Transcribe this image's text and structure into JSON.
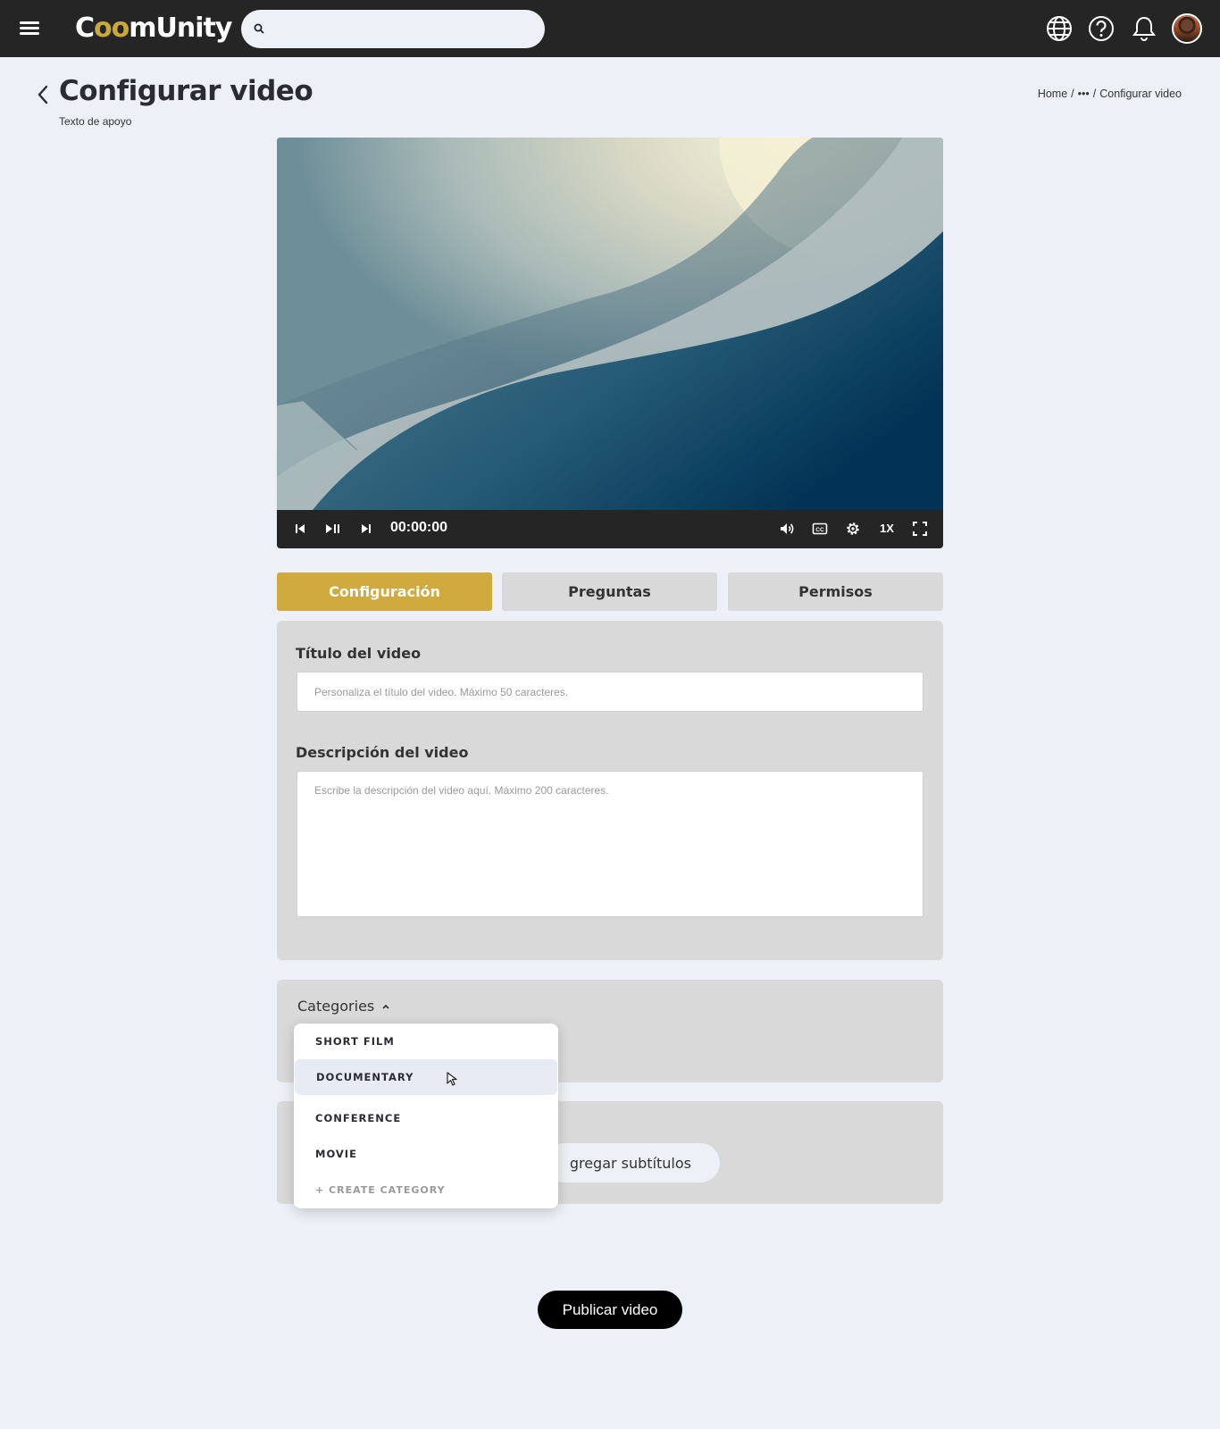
{
  "topbar": {
    "logo_text_a": "C",
    "logo_text_gold": "oo",
    "logo_text_b": "mUnity",
    "search": {
      "placeholder": "",
      "value": ""
    },
    "icons": [
      "hamburger-menu-icon",
      "globe-icon",
      "help-icon",
      "bell-icon",
      "avatar"
    ]
  },
  "header": {
    "title": "Configurar video",
    "subtitle": "Texto de apoyo",
    "breadcrumb": {
      "home": "Home",
      "sep1": "/",
      "ellipsis": "•••",
      "sep2": "/",
      "current": "Configurar video"
    }
  },
  "player": {
    "time": "00:00:00",
    "speed": "1X"
  },
  "tabs": [
    {
      "label": "Configuración",
      "active": true
    },
    {
      "label": "Preguntas",
      "active": false
    },
    {
      "label": "Permisos",
      "active": false
    }
  ],
  "form": {
    "title_label": "Título del video",
    "title_placeholder": "Personaliza el título del video. Máximo 50 caracteres.",
    "title_value": "",
    "desc_label": "Descripción del video",
    "desc_placeholder": "Escribe la descripción del video aquí. Máximo 200 caracteres.",
    "desc_value": ""
  },
  "categories": {
    "label": "Categories",
    "expanded": true,
    "options": [
      "SHORT FILM",
      "DOCUMENTARY",
      "CONFERENCE",
      "MOVIE"
    ],
    "hovered": "DOCUMENTARY",
    "create_label": "+ CREATE CATEGORY"
  },
  "subtitles": {
    "button_label": "gregar subtítulos"
  },
  "publish_label": "Publicar video",
  "colors": {
    "topbar": "#252525",
    "background": "#edf0f7",
    "accent": "#cfaa3f",
    "panel": "#d9d9d9",
    "publish": "#000000"
  }
}
